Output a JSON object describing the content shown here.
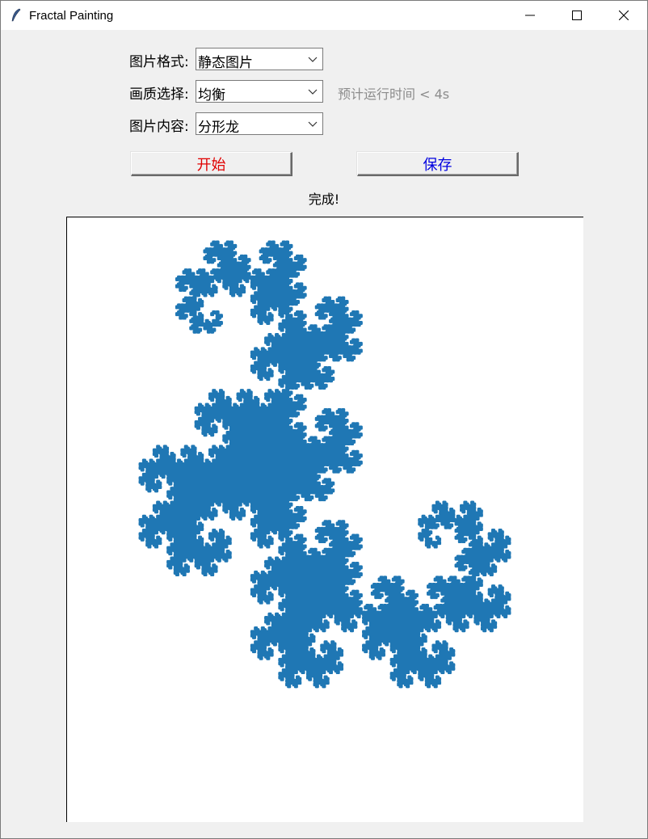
{
  "window": {
    "title": "Fractal Painting",
    "icon": "feather-icon",
    "controls": [
      "minimize-icon",
      "maximize-icon",
      "close-icon"
    ]
  },
  "form": {
    "format_label": "图片格式:",
    "format_value": "静态图片",
    "quality_label": "画质选择:",
    "quality_value": "均衡",
    "quality_hint": "预计运行时间 < 4s",
    "content_label": "图片内容:",
    "content_value": "分形龙"
  },
  "buttons": {
    "start_label": "开始",
    "start_color": "#e00000",
    "save_label": "保存",
    "save_color": "#0000e0"
  },
  "status_text": "完成!",
  "canvas": {
    "fill_color": "#1f77b4",
    "fractal": "dragon-curve"
  }
}
